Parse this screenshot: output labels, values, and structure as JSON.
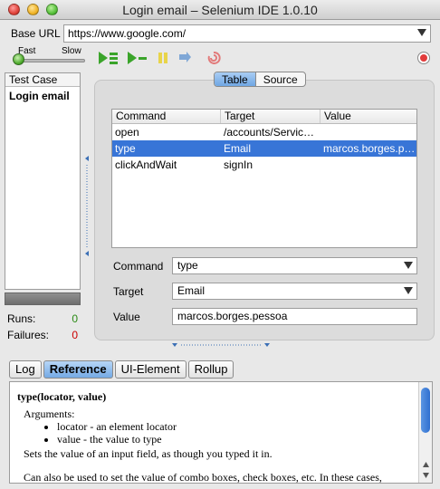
{
  "window": {
    "title": "Login email – Selenium IDE 1.0.10"
  },
  "base_url": {
    "label": "Base URL",
    "value": "https://www.google.com/"
  },
  "speed": {
    "fast_label": "Fast",
    "slow_label": "Slow"
  },
  "test_case_panel": {
    "header": "Test Case",
    "items": [
      {
        "label": "Login email"
      }
    ],
    "runs_label": "Runs:",
    "runs_value": "0",
    "failures_label": "Failures:",
    "failures_value": "0"
  },
  "view_tabs": [
    {
      "label": "Table",
      "active": true
    },
    {
      "label": "Source",
      "active": false
    }
  ],
  "command_table": {
    "headers": [
      "Command",
      "Target",
      "Value"
    ],
    "rows": [
      {
        "command": "open",
        "target": "/accounts/Servic…",
        "value": "",
        "selected": false
      },
      {
        "command": "type",
        "target": "Email",
        "value": "marcos.borges.p…",
        "selected": true
      },
      {
        "command": "clickAndWait",
        "target": "signIn",
        "value": "",
        "selected": false
      }
    ]
  },
  "editor": {
    "command_label": "Command",
    "command_value": "type",
    "target_label": "Target",
    "target_value": "Email",
    "value_label": "Value",
    "value_value": "marcos.borges.pessoa"
  },
  "bottom_tabs": [
    {
      "label": "Log",
      "active": false
    },
    {
      "label": "Reference",
      "active": true
    },
    {
      "label": "UI-Element",
      "active": false
    },
    {
      "label": "Rollup",
      "active": false
    }
  ],
  "reference": {
    "signature": "type(locator, value)",
    "args_label": "Arguments:",
    "args": [
      "locator - an element locator",
      "value - the value to type"
    ],
    "description": "Sets the value of an input field, as though you typed it in.",
    "description2": "Can also be used to set the value of combo boxes, check boxes, etc. In these cases,"
  },
  "colors": {
    "selection": "#3875d7",
    "failures": "#cc0000",
    "runs": "#2a8a14"
  }
}
